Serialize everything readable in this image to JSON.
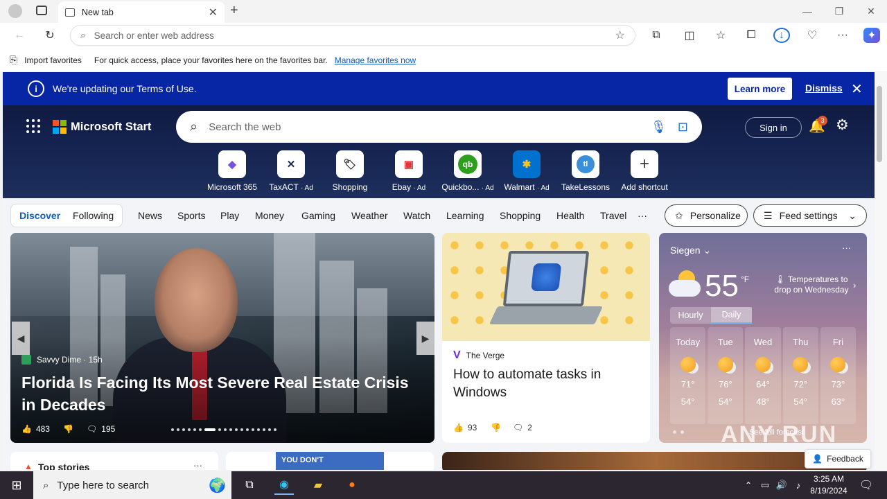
{
  "browser": {
    "tab_title": "New tab",
    "address_placeholder": "Search or enter web address",
    "favorites_bar": {
      "import_label": "Import favorites",
      "hint_text": "For quick access, place your favorites here on the favorites bar.",
      "manage_link": "Manage favorites now"
    }
  },
  "banner": {
    "message": "We're updating our Terms of Use.",
    "learn_more": "Learn more",
    "dismiss": "Dismiss"
  },
  "header": {
    "brand": "Microsoft Start",
    "search_placeholder": "Search the web",
    "sign_in": "Sign in",
    "notification_count": "3"
  },
  "shortcuts": [
    {
      "label": "Microsoft 365",
      "ad": "",
      "glyph": "◆",
      "color": "#7b4fe0"
    },
    {
      "label": "TaxACT",
      "ad": "· Ad",
      "glyph": "✕",
      "color": "#1a2a5c"
    },
    {
      "label": "Shopping",
      "ad": "",
      "glyph": "🏷",
      "color": "#333333"
    },
    {
      "label": "Ebay",
      "ad": "· Ad",
      "glyph": "▣",
      "color": "#e53238"
    },
    {
      "label": "Quickbo...",
      "ad": "· Ad",
      "glyph": "qb",
      "color": "#2ca01c"
    },
    {
      "label": "Walmart",
      "ad": "· Ad",
      "glyph": "✱",
      "color": "#0071ce"
    },
    {
      "label": "TakeLessons",
      "ad": "",
      "glyph": "tl",
      "color": "#3b8fd9"
    },
    {
      "label": "Add shortcut",
      "ad": "",
      "glyph": "+",
      "color": "#333333"
    }
  ],
  "nav": {
    "discover": "Discover",
    "following": "Following",
    "items": [
      "News",
      "Sports",
      "Play",
      "Money",
      "Gaming",
      "Weather",
      "Watch",
      "Learning",
      "Shopping",
      "Health",
      "Travel"
    ],
    "more": "···",
    "personalize": "Personalize",
    "feed_settings": "Feed settings"
  },
  "hero_card": {
    "source": "Savvy Dime · 15h",
    "headline": "Florida Is Facing Its Most Severe Real Estate Crisis in Decades",
    "likes": "483",
    "comments": "195"
  },
  "verge_card": {
    "source": "The Verge",
    "headline": "How to automate tasks in Windows",
    "likes": "93",
    "comments": "2"
  },
  "weather": {
    "city": "Siegen",
    "temp": "55",
    "unit": "°F",
    "alert": "Temperatures to drop on Wednesday",
    "tab_hourly": "Hourly",
    "tab_daily": "Daily",
    "days": [
      {
        "name": "Today",
        "hi": "71°",
        "lo": "54°"
      },
      {
        "name": "Tue",
        "hi": "76°",
        "lo": "54°"
      },
      {
        "name": "Wed",
        "hi": "64°",
        "lo": "48°"
      },
      {
        "name": "Thu",
        "hi": "72°",
        "lo": "54°"
      },
      {
        "name": "Fri",
        "hi": "73°",
        "lo": "63°"
      }
    ],
    "footer": "See full forecast"
  },
  "bottom": {
    "top_stories": "Top stories",
    "ad_text": "YOU DON'T",
    "feedback": "Feedback"
  },
  "taskbar": {
    "search_placeholder": "Type here to search",
    "time": "3:25 AM",
    "date": "8/19/2024"
  },
  "watermark": "ANY RUN"
}
